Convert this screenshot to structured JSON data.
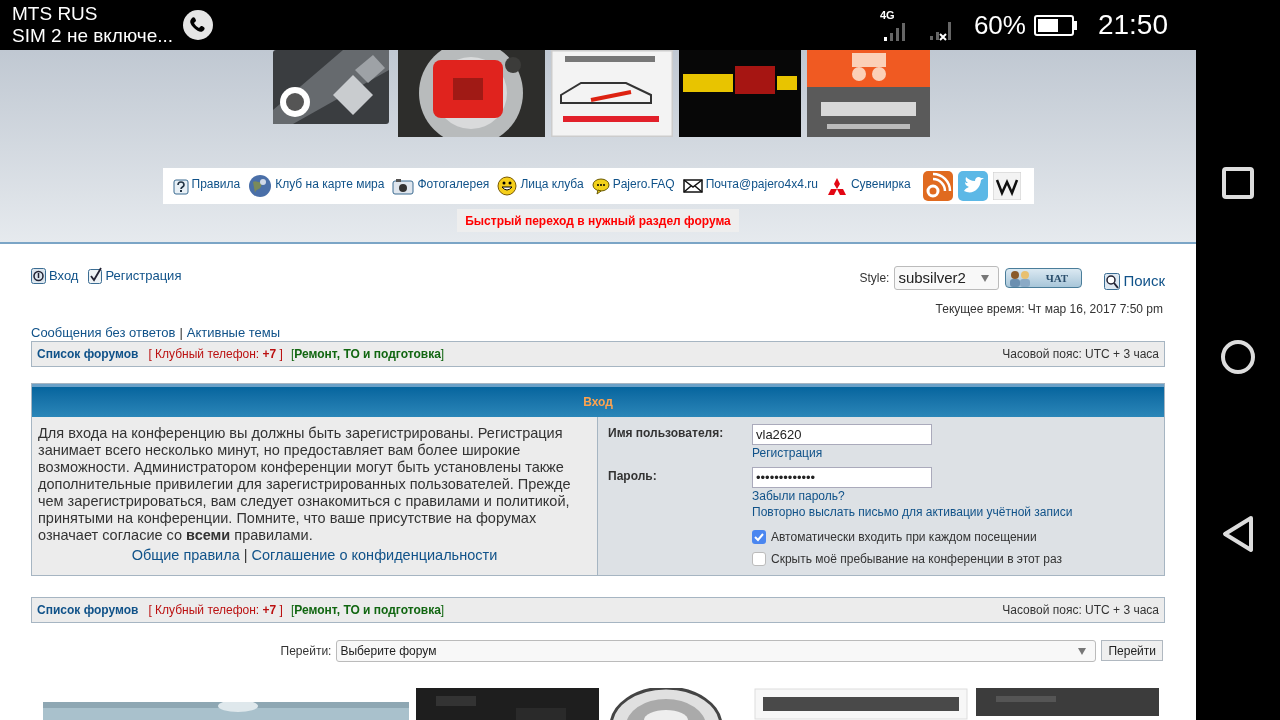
{
  "status_bar": {
    "carrier": "MTS RUS",
    "sim": "SIM 2 не включе...",
    "network": "4G",
    "battery": "60%",
    "time": "21:50"
  },
  "header": {
    "nav_links": [
      "Правила",
      "Клуб на карте мира",
      "Фотогалерея",
      "Лица клуба",
      "Pajero.FAQ",
      "Почта@pajero4x4.ru",
      "Сувенирка"
    ],
    "quick_jump": "Быстрый переход в нужный раздел форума"
  },
  "user_links": [
    "Вход",
    "Регистрация"
  ],
  "style_select": {
    "label": "Style:",
    "value": "subsilver2"
  },
  "chat_button": "ЧАТ",
  "search_link": "Поиск",
  "current_time": "Текущее время: Чт мар 16, 2017 7:50 pm",
  "quick_links": {
    "items": [
      "Сообщения без ответов",
      "Активные темы"
    ],
    "separator": "|"
  },
  "breadcrumbs": [
    {
      "forum_index": "Список форумов",
      "phone": "[ Клубный телефон: **+7** ]",
      "repair": "[**Ремонт, ТО и подготовка**]",
      "timezone": "Часовой пояс: UTC + 3 часа"
    },
    {
      "forum_index": "Список форумов",
      "phone": "[ Клубный телефон: **+7** ]",
      "repair": "[**Ремонт, ТО и подготовка**]",
      "timezone": "Часовой пояс: UTC + 3 часа"
    }
  ],
  "login_panel": {
    "title": "Вход",
    "intro": "Для входа на конференцию вы должны быть зарегистрированы. Регистрация занимает всего несколько минут, но предоставляет вам более широкие возможности. Администратором конференции могут быть установлены также дополнительные привилегии для зарегистрированных пользователей. Прежде чем зарегистрироваться, вам следует ознакомиться с правилами и политикой, принятыми на конференции. Помните, что ваше присутствие на форумах означает согласие со **всеми** правилами.",
    "intro_links": [
      "Общие правила",
      "Соглашение о конфиденциальности"
    ],
    "intro_separator": "|",
    "fields": [
      {
        "label": "Имя пользователя:",
        "value": "vla2620",
        "links": [
          "Регистрация"
        ]
      },
      {
        "label": "Пароль:",
        "value": "•••••••••••••",
        "links": [
          "Забыли пароль?",
          "Повторно выслать письмо для активации учётной записи"
        ]
      }
    ],
    "checkboxes": [
      {
        "label": "Автоматически входить при каждом посещении",
        "checked": true
      },
      {
        "label": "Скрыть моё пребывание на конференции в этот раз",
        "checked": false
      }
    ]
  },
  "jump": {
    "label": "Перейти:",
    "value": "Выберите форум",
    "button": "Перейти"
  }
}
